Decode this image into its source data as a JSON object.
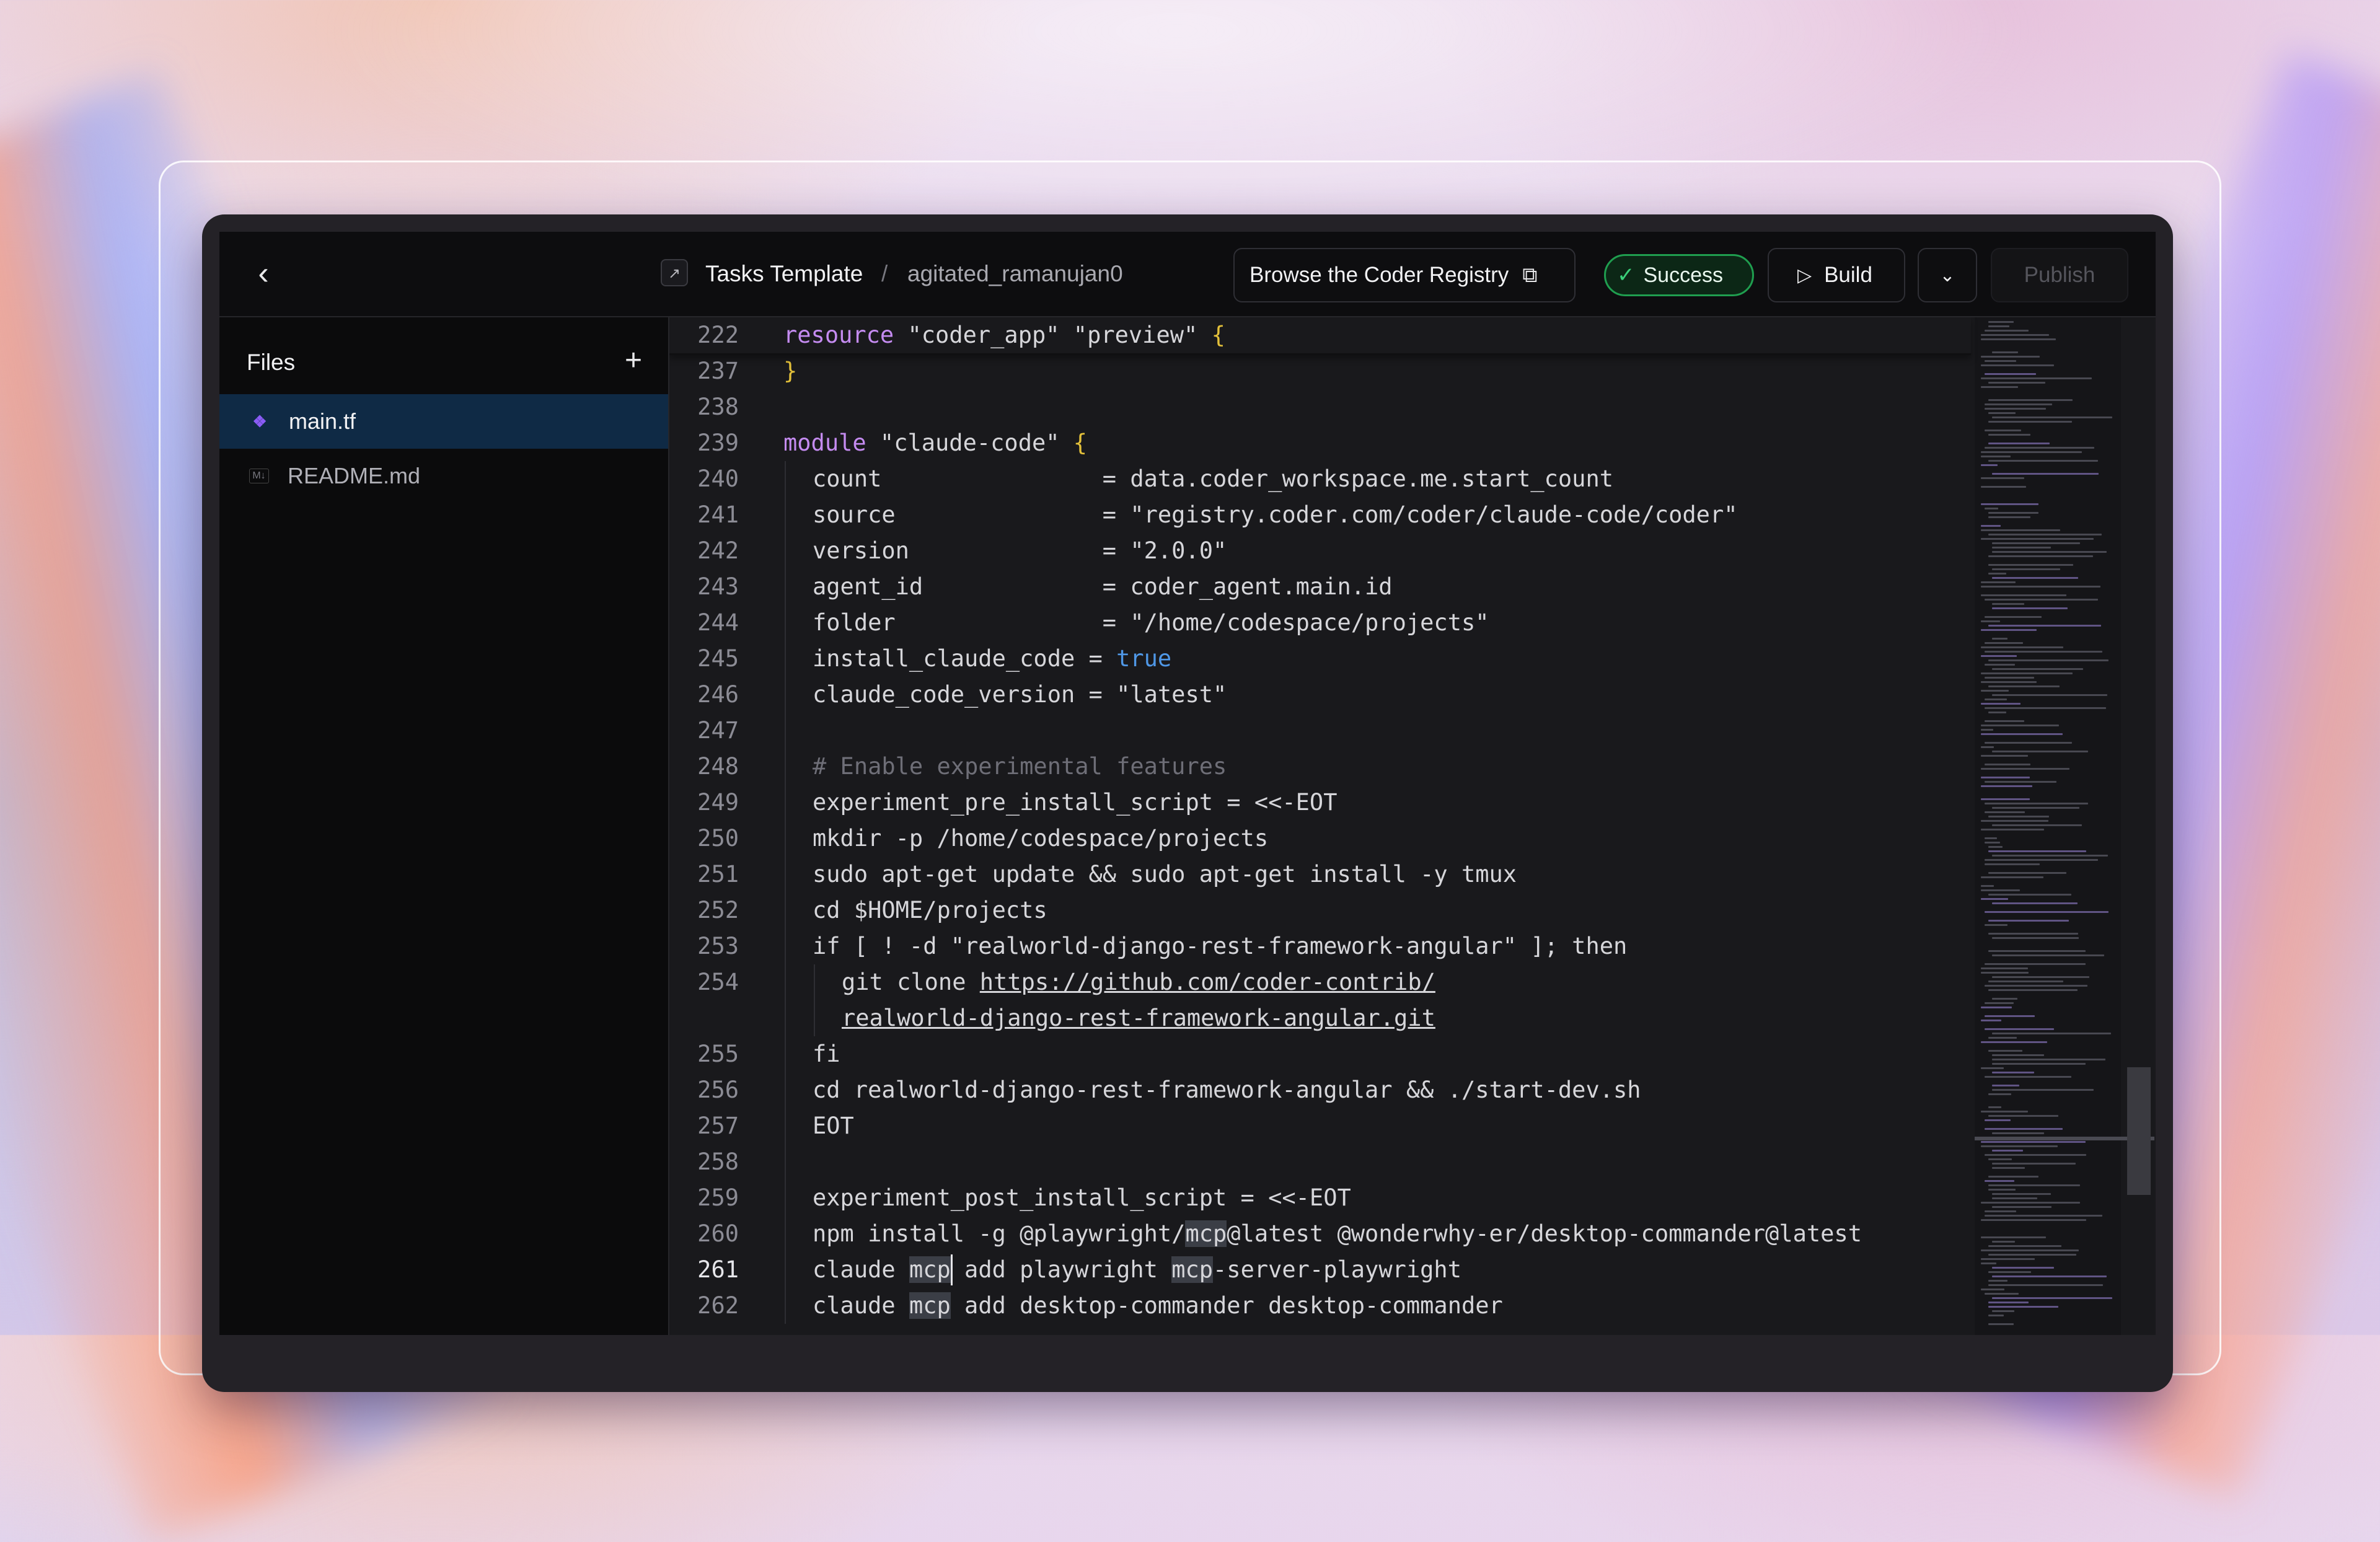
{
  "topbar": {
    "back_icon": "chevron-left-icon",
    "project_name": "Tasks Template",
    "separator": "/",
    "workspace_name": "agitated_ramanujan0",
    "registry_button": "Browse the Coder Registry",
    "status": "Success",
    "build_button": "Build",
    "publish_button": "Publish",
    "colors": {
      "success": "#1f9e4f",
      "background": "#0d0d0f"
    }
  },
  "sidebar": {
    "title": "Files",
    "files": [
      {
        "name": "main.tf",
        "icon": "terraform-icon",
        "active": true
      },
      {
        "name": "README.md",
        "icon": "markdown-icon",
        "active": false
      }
    ]
  },
  "editor": {
    "sticky": {
      "num": "222",
      "segments": [
        {
          "t": "resource",
          "c": "kw"
        },
        {
          "t": " \"coder_app\" \"preview\" ",
          "c": ""
        },
        {
          "t": "{",
          "c": "brace"
        }
      ]
    },
    "lines": [
      {
        "num": "237",
        "indent": 0,
        "segments": [
          {
            "t": "}",
            "c": "brace"
          }
        ]
      },
      {
        "num": "238",
        "indent": 0,
        "segments": []
      },
      {
        "num": "239",
        "indent": 0,
        "segments": [
          {
            "t": "module",
            "c": "kw"
          },
          {
            "t": " \"claude-code\" ",
            "c": ""
          },
          {
            "t": "{",
            "c": "brace"
          }
        ]
      },
      {
        "num": "240",
        "indent": 1,
        "segments": [
          {
            "t": "count                = data.coder_workspace.me.start_count",
            "c": ""
          }
        ]
      },
      {
        "num": "241",
        "indent": 1,
        "segments": [
          {
            "t": "source               = ",
            "c": ""
          },
          {
            "t": "\"registry.coder.com/coder/claude-code/coder\"",
            "c": "str"
          }
        ]
      },
      {
        "num": "242",
        "indent": 1,
        "segments": [
          {
            "t": "version              = ",
            "c": ""
          },
          {
            "t": "\"2.0.0\"",
            "c": "str"
          }
        ]
      },
      {
        "num": "243",
        "indent": 1,
        "segments": [
          {
            "t": "agent_id             = coder_agent.main.id",
            "c": ""
          }
        ]
      },
      {
        "num": "244",
        "indent": 1,
        "segments": [
          {
            "t": "folder               = ",
            "c": ""
          },
          {
            "t": "\"/home/codespace/projects\"",
            "c": "str"
          }
        ]
      },
      {
        "num": "245",
        "indent": 1,
        "segments": [
          {
            "t": "install_claude_code = ",
            "c": ""
          },
          {
            "t": "true",
            "c": "bool"
          }
        ]
      },
      {
        "num": "246",
        "indent": 1,
        "segments": [
          {
            "t": "claude_code_version = ",
            "c": ""
          },
          {
            "t": "\"latest\"",
            "c": "str"
          }
        ]
      },
      {
        "num": "247",
        "indent": 1,
        "segments": []
      },
      {
        "num": "248",
        "indent": 1,
        "segments": [
          {
            "t": "# Enable experimental features",
            "c": "cm"
          }
        ]
      },
      {
        "num": "249",
        "indent": 1,
        "segments": [
          {
            "t": "experiment_pre_install_script = <<-EOT",
            "c": ""
          }
        ]
      },
      {
        "num": "250",
        "indent": 1,
        "segments": [
          {
            "t": "mkdir -p /home/codespace/projects",
            "c": ""
          }
        ]
      },
      {
        "num": "251",
        "indent": 1,
        "segments": [
          {
            "t": "sudo apt-get update && sudo apt-get install -y tmux",
            "c": ""
          }
        ]
      },
      {
        "num": "252",
        "indent": 1,
        "segments": [
          {
            "t": "cd $HOME/projects",
            "c": ""
          }
        ]
      },
      {
        "num": "253",
        "indent": 1,
        "segments": [
          {
            "t": "if [ ! -d \"realworld-django-rest-framework-angular\" ]; then",
            "c": ""
          }
        ]
      },
      {
        "num": "254",
        "indent": 2,
        "segments": [
          {
            "t": "git clone ",
            "c": ""
          },
          {
            "t": "https://github.com/coder-contrib/",
            "c": "url"
          }
        ]
      },
      {
        "num": "",
        "indent": 2,
        "segments": [
          {
            "t": "realworld-django-rest-framework-angular.git",
            "c": "url"
          }
        ]
      },
      {
        "num": "255",
        "indent": 1,
        "segments": [
          {
            "t": "fi",
            "c": ""
          }
        ]
      },
      {
        "num": "256",
        "indent": 1,
        "segments": [
          {
            "t": "cd realworld-django-rest-framework-angular && ./start-dev.sh",
            "c": ""
          }
        ]
      },
      {
        "num": "257",
        "indent": 1,
        "segments": [
          {
            "t": "EOT",
            "c": ""
          }
        ]
      },
      {
        "num": "258",
        "indent": 1,
        "segments": []
      },
      {
        "num": "259",
        "indent": 1,
        "segments": [
          {
            "t": "experiment_post_install_script = <<-EOT",
            "c": ""
          }
        ]
      },
      {
        "num": "260",
        "indent": 1,
        "segments": [
          {
            "t": "npm install -g @playwright/",
            "c": ""
          },
          {
            "t": "mcp",
            "c": "hl"
          },
          {
            "t": "@latest @wonderwhy-er/desktop-commander@latest",
            "c": ""
          }
        ]
      },
      {
        "num": "261",
        "indent": 1,
        "current": true,
        "segments": [
          {
            "t": "claude ",
            "c": ""
          },
          {
            "t": "mcp",
            "c": "hl"
          },
          {
            "t": " add playwright ",
            "c": ""
          },
          {
            "t": "mcp",
            "c": "hl"
          },
          {
            "t": "-server-playwright",
            "c": ""
          }
        ]
      },
      {
        "num": "262",
        "indent": 1,
        "segments": [
          {
            "t": "claude ",
            "c": ""
          },
          {
            "t": "mcp",
            "c": "hl"
          },
          {
            "t": " add desktop-commander desktop-commander",
            "c": ""
          }
        ]
      }
    ]
  }
}
